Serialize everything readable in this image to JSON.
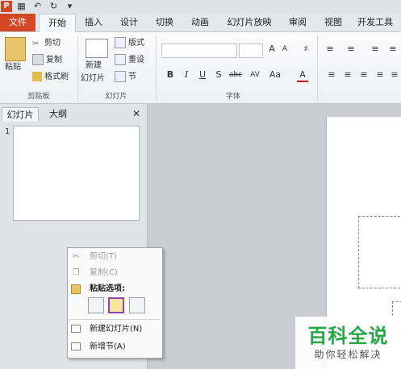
{
  "quick_access": {
    "logo": "P",
    "save_icon": "save-icon",
    "undo_icon": "undo-icon",
    "redo_icon": "redo-icon",
    "customize_icon": "customize-icon"
  },
  "tabs": [
    {
      "label": "文件"
    },
    {
      "label": "开始"
    },
    {
      "label": "插入"
    },
    {
      "label": "设计"
    },
    {
      "label": "切换"
    },
    {
      "label": "动画"
    },
    {
      "label": "幻灯片放映"
    },
    {
      "label": "审阅"
    },
    {
      "label": "视图"
    },
    {
      "label": "开发工具"
    }
  ],
  "ribbon": {
    "clipboard": {
      "paste": "粘贴",
      "cut": "剪切",
      "copy": "复制",
      "format_painter": "格式刷",
      "group": "剪贴板"
    },
    "slides": {
      "new_slide_line1": "新建",
      "new_slide_line2": "幻灯片",
      "layout": "版式",
      "reset": "重设",
      "section": "节",
      "group": "幻灯片"
    },
    "font": {
      "bold": "B",
      "italic": "I",
      "underline": "U",
      "shadow": "S",
      "strike": "abc",
      "spacing": "AV",
      "case": "Aa",
      "color": "A",
      "grow": "A",
      "shrink": "A",
      "group": "字体"
    }
  },
  "panel": {
    "tab_slides": "幻灯片",
    "tab_outline": "大纲",
    "close": "✕",
    "slide_number": "1"
  },
  "context_menu": {
    "cut": "剪切(T)",
    "copy": "复制(C)",
    "paste_options": "粘贴选项:",
    "new_slide": "新建幻灯片(N)",
    "new_section": "新增节(A)"
  },
  "watermark": {
    "title": "百科全说",
    "subtitle": "助你轻松解决"
  },
  "colors": {
    "file_tab": "#d24726",
    "selection": "#8e44ad",
    "watermark": "#28a745"
  }
}
